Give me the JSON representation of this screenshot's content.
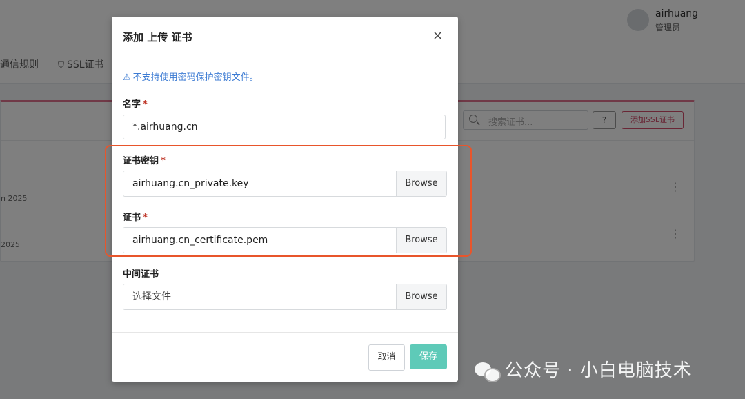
{
  "app": {
    "user": {
      "name": "airhuang",
      "role": "管理员"
    },
    "nav": [
      {
        "label": "通信规则"
      },
      {
        "label": "SSL证书",
        "icon": "shield-icon"
      }
    ],
    "card": {
      "search_placeholder": "搜索证书...",
      "help_label": "?",
      "add_button": "添加SSL证书",
      "rows": [
        {
          "date": "n 2025"
        },
        {
          "date": "2025"
        }
      ]
    }
  },
  "modal": {
    "title": "添加 上传 证书",
    "close_glyph": "×",
    "warning": "不支持使用密码保护密钥文件。",
    "warning_icon": "⚠",
    "fields": {
      "name": {
        "label": "名字",
        "required": "*",
        "value": "*.airhuang.cn"
      },
      "key": {
        "label": "证书密钥",
        "required": "*",
        "file": "airhuang.cn_private.key",
        "browse": "Browse"
      },
      "cert": {
        "label": "证书",
        "required": "*",
        "file": "airhuang.cn_certificate.pem",
        "browse": "Browse"
      },
      "intermediate": {
        "label": "中间证书",
        "file": "选择文件",
        "browse": "Browse"
      }
    },
    "buttons": {
      "cancel": "取消",
      "save": "保存"
    }
  },
  "watermark": "公众号 · 小白电脑技术",
  "colors": {
    "accent": "#d34d6b",
    "save": "#5ecab8",
    "warning": "#3c7bd3",
    "highlight": "#e8552b"
  }
}
